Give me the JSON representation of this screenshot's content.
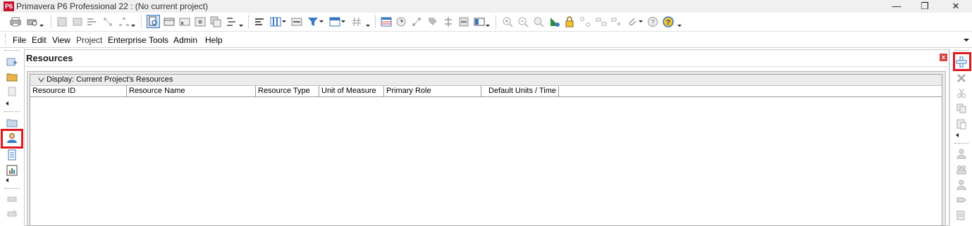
{
  "window": {
    "logo_text": "P6",
    "title": "Primavera P6 Professional 22 : (No current project)",
    "minimize": "—",
    "maximize": "❐",
    "close": "✕"
  },
  "menu": {
    "file": "File",
    "edit": "Edit",
    "view": "View",
    "project": "Project",
    "enterprise": "Enterprise",
    "tools": "Tools",
    "admin": "Admin",
    "help": "Help"
  },
  "panel": {
    "title": "Resources",
    "close": "x",
    "display_label": "Display: Current Project's Resources"
  },
  "columns": [
    {
      "label": "Resource ID"
    },
    {
      "label": "Resource Name"
    },
    {
      "label": "Resource Type"
    },
    {
      "label": "Unit of Measure"
    },
    {
      "label": "Primary Role"
    },
    {
      "label": "Default Units / Time"
    }
  ],
  "colors": {
    "highlight": "#e0191f",
    "logo": "#c8102e",
    "accent_blue": "#3a78c4"
  }
}
